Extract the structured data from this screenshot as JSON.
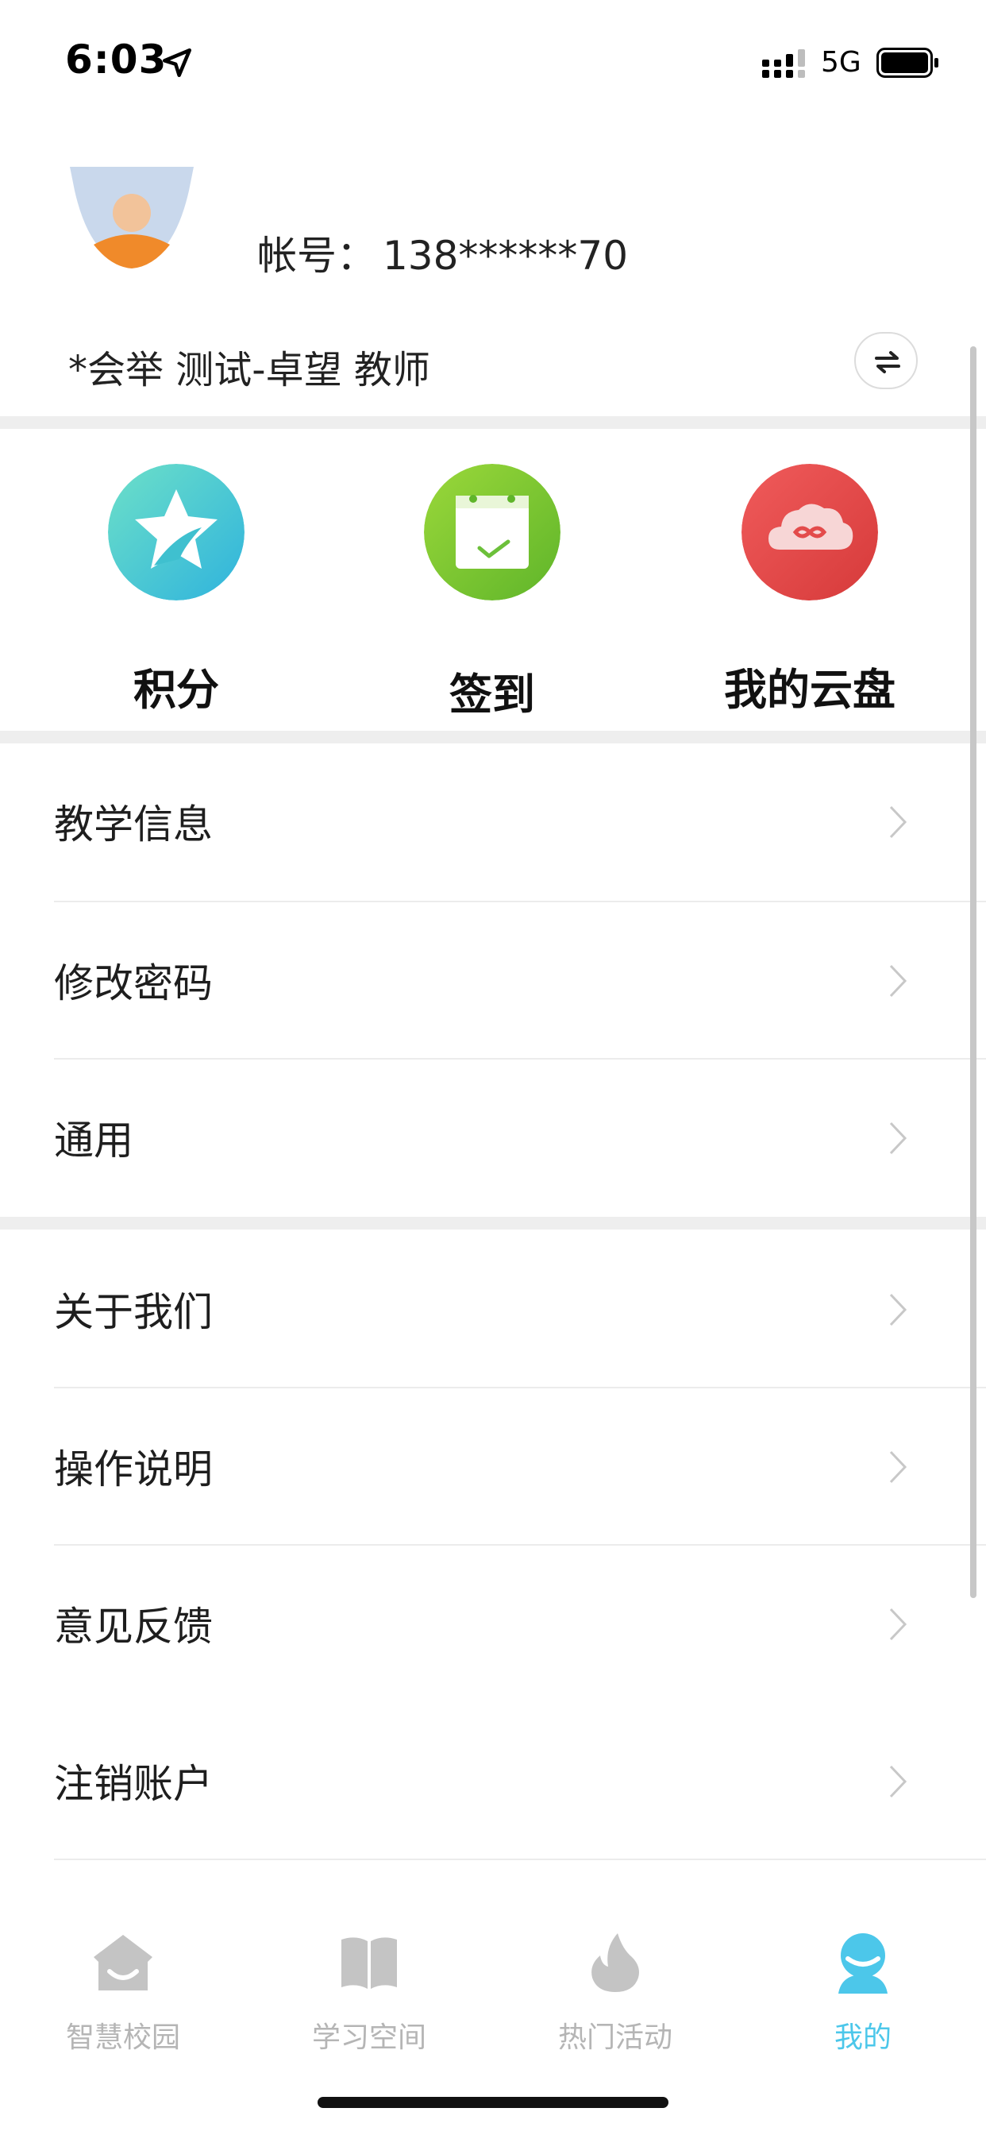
{
  "status_bar": {
    "time": "6:03",
    "network": "5G"
  },
  "profile": {
    "account_label": "帐号：",
    "account_value": "138******70",
    "role": "*会举 测试-卓望 教师"
  },
  "quick_actions": [
    {
      "label": "积分",
      "icon": "star-icon",
      "color": "#45c7d8"
    },
    {
      "label": "签到",
      "icon": "calendar-check-icon",
      "color": "#7cc832"
    },
    {
      "label": "我的云盘",
      "icon": "cloud-icon",
      "color": "#e34b4b"
    }
  ],
  "menu_group_1": [
    {
      "label": "教学信息"
    },
    {
      "label": "修改密码"
    },
    {
      "label": "通用"
    }
  ],
  "menu_group_2": [
    {
      "label": "关于我们"
    },
    {
      "label": "操作说明"
    },
    {
      "label": "意见反馈"
    },
    {
      "label": "注销账户"
    }
  ],
  "tab_bar": {
    "tabs": [
      {
        "label": "智慧校园",
        "icon": "house-icon",
        "active": false
      },
      {
        "label": "学习空间",
        "icon": "book-icon",
        "active": false
      },
      {
        "label": "热门活动",
        "icon": "flame-icon",
        "active": false
      },
      {
        "label": "我的",
        "icon": "person-icon",
        "active": true
      }
    ],
    "active_color": "#4cc7ea",
    "inactive_color": "#b5b5b5"
  }
}
